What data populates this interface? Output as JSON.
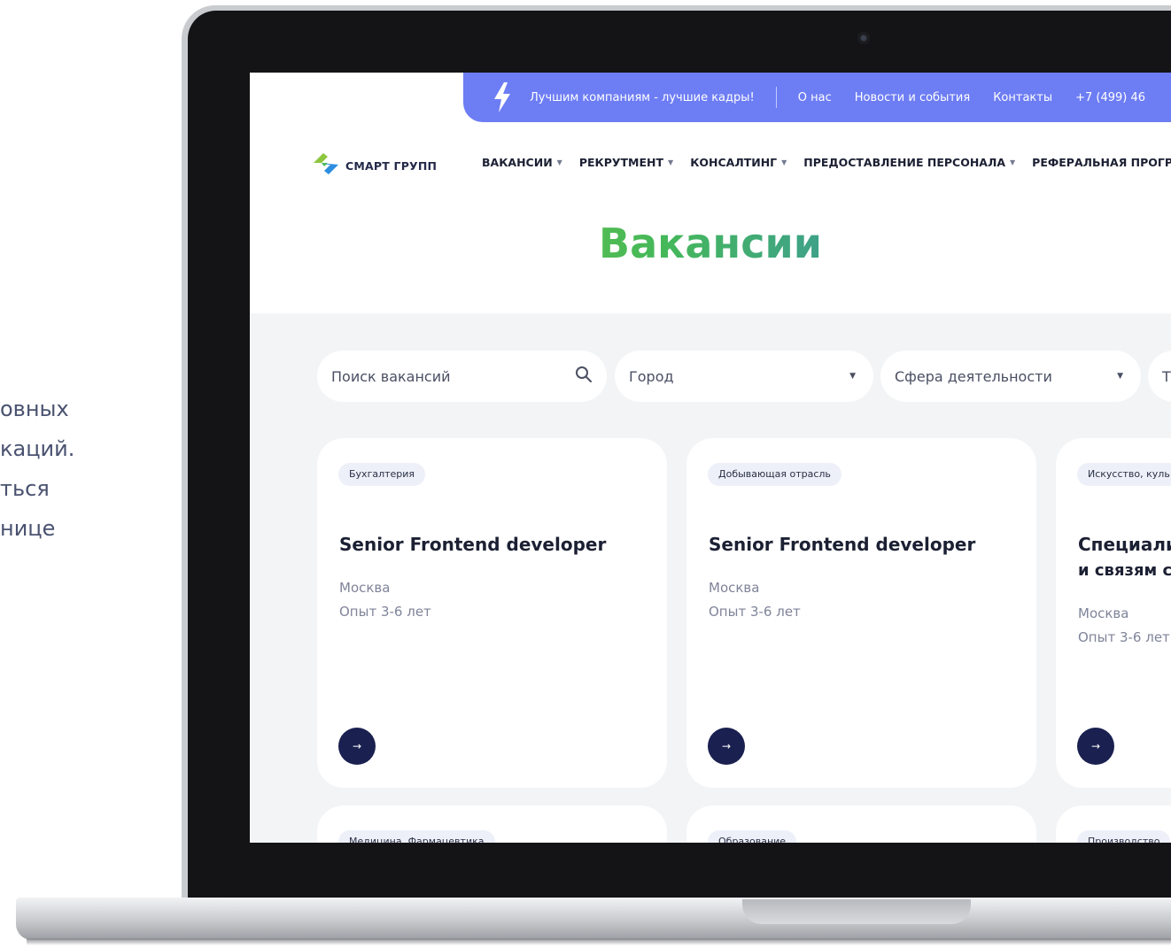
{
  "side_text": [
    "овных",
    "каций.",
    "ться",
    "нице"
  ],
  "topbar": {
    "slogan": "Лучшим компаниям - лучшие кадры!",
    "links": [
      "О нас",
      "Новости и события",
      "Контакты",
      "+7 (499) 46"
    ]
  },
  "header": {
    "logo": "СМАРТ ГРУПП",
    "nav": [
      "ВАКАНСИИ",
      "РЕКРУТМЕНТ",
      "КОНСАЛТИНГ",
      "ПРЕДОСТАВЛЕНИЕ ПЕРСОНАЛА",
      "РЕФЕРАЛЬНАЯ ПРОГРА"
    ]
  },
  "page_title": "Вакансии",
  "filters": {
    "search_placeholder": "Поиск вакансий",
    "city": "Город",
    "sphere": "Сфера деятельности",
    "fourth": "Т"
  },
  "cards": [
    {
      "tag": "Бухгалтерия",
      "title": "Senior Frontend developer",
      "title2": "",
      "city": "Москва",
      "experience": "Опыт 3-6 лет"
    },
    {
      "tag": "Добывающая отрасль",
      "title": "Senior Frontend developer",
      "title2": "",
      "city": "Москва",
      "experience": "Опыт 3-6 лет"
    },
    {
      "tag": "Искусство, куль",
      "title": "Специали",
      "title2": "и связям с",
      "city": "Москва",
      "experience": "Опыт 3-6 лет"
    }
  ],
  "cards_row2": [
    {
      "tag": "Медицина, Фармацевтика"
    },
    {
      "tag": "Образование"
    },
    {
      "tag": "Производство"
    }
  ],
  "colors": {
    "topbar": "#6d7df4",
    "arrow_button": "#1a2050",
    "background": "#f3f4f6"
  }
}
